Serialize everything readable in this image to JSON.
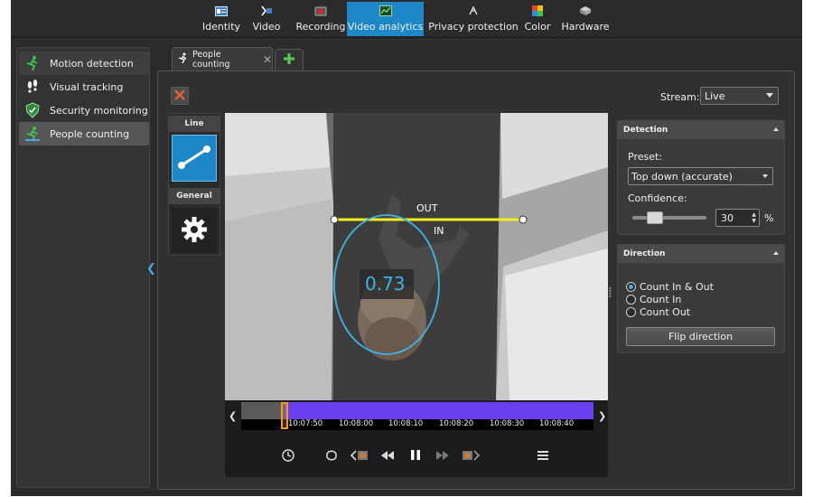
{
  "topbar": {
    "items": [
      {
        "label": "Identity",
        "icon": "id-card-icon"
      },
      {
        "label": "Video",
        "icon": "video-settings-icon"
      },
      {
        "label": "Recording",
        "icon": "recording-icon"
      },
      {
        "label": "Video analytics",
        "icon": "analytics-icon",
        "active": true
      },
      {
        "label": "Privacy protection",
        "icon": "privacy-icon"
      },
      {
        "label": "Color",
        "icon": "color-icon"
      },
      {
        "label": "Hardware",
        "icon": "hardware-icon"
      }
    ],
    "accent": "#1e87c8"
  },
  "sidebar": {
    "items": [
      {
        "label": "Motion detection",
        "icon": "motion-icon"
      },
      {
        "label": "Visual tracking",
        "icon": "footprints-icon"
      },
      {
        "label": "Security monitoring",
        "icon": "shield-icon"
      },
      {
        "label": "People counting",
        "icon": "person-running-icon",
        "active": true
      }
    ]
  },
  "tab": {
    "label": "People counting",
    "close": "✕"
  },
  "stream": {
    "label": "Stream:",
    "value": "Live"
  },
  "tools": {
    "line_header": "Line",
    "general_header": "General"
  },
  "video": {
    "out_label": "OUT",
    "in_label": "IN",
    "confidence_overlay": "0.73",
    "line_color": "#f2f01a",
    "ellipse_color": "#3fb4e8"
  },
  "timeline": {
    "labels": [
      "10:07:50",
      "10:08:00",
      "10:08:10",
      "10:08:20",
      "10:08:30",
      "10:08:40"
    ],
    "played_color": "#6a3ff0",
    "cursor_color": "#f29d1a"
  },
  "detection": {
    "header": "Detection",
    "preset_label": "Preset:",
    "preset_value": "Top down (accurate)",
    "confidence_label": "Confidence:",
    "confidence_value": "30",
    "confidence_unit": "%"
  },
  "direction": {
    "header": "Direction",
    "options": [
      "Count In & Out",
      "Count In",
      "Count Out"
    ],
    "selected": 0,
    "flip_button": "Flip direction"
  }
}
